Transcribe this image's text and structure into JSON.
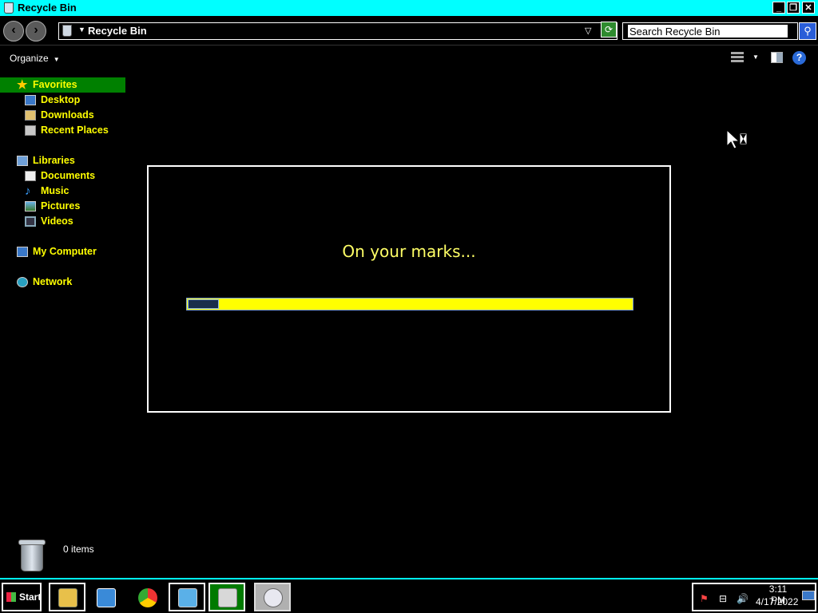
{
  "window": {
    "title": "Recycle Bin",
    "minimize": "_",
    "maximize": "❐",
    "close": "✕"
  },
  "address": {
    "crumb": "Recycle Bin",
    "search_placeholder": "Search Recycle Bin"
  },
  "commandbar": {
    "organize": "Organize",
    "help": "?"
  },
  "sidebar": {
    "favorites": "Favorites",
    "desktop": "Desktop",
    "downloads": "Downloads",
    "recent_places": "Recent Places",
    "libraries": "Libraries",
    "documents": "Documents",
    "music": "Music",
    "pictures": "Pictures",
    "videos": "Videos",
    "my_computer": "My Computer",
    "network": "Network"
  },
  "dialog": {
    "message": "On your marks...",
    "progress_fraction": 0.07
  },
  "details": {
    "item_count": "0 items"
  },
  "taskbar": {
    "start": "Start",
    "time": "3:11 PM",
    "date": "4/17/2022"
  },
  "colors": {
    "titlebar": "#00ffff",
    "nav_text": "#ffff00",
    "selected_bg": "#008000",
    "message_text": "#ffff66",
    "progress_fill": "#ffff00"
  }
}
